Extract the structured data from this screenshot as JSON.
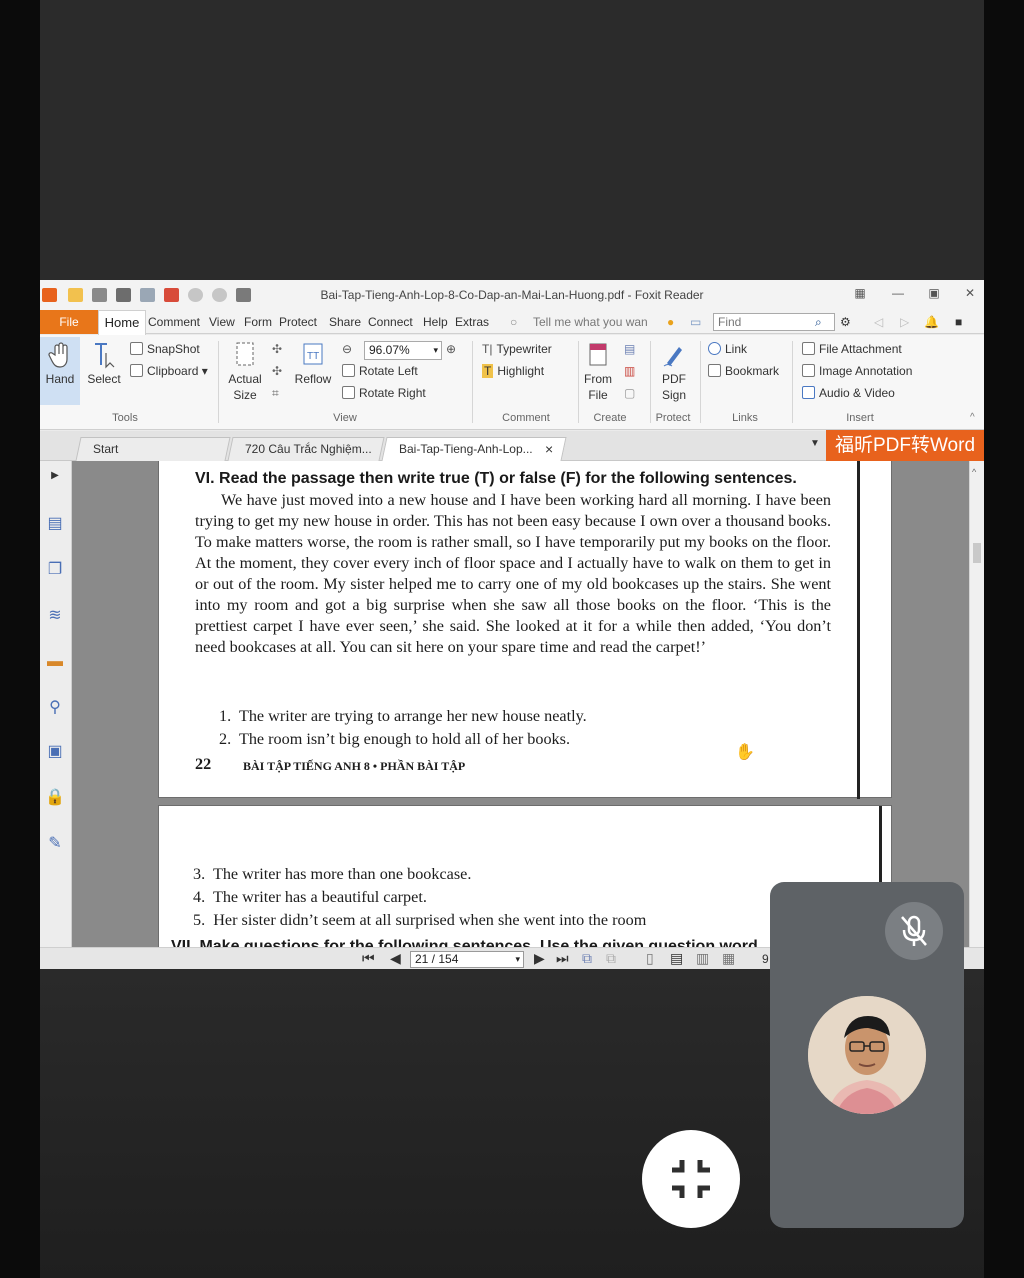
{
  "window": {
    "title": "Bai-Tap-Tieng-Anh-Lop-8-Co-Dap-an-Mai-Lan-Huong.pdf - Foxit Reader"
  },
  "menu": {
    "file": "File",
    "home": "Home",
    "items": [
      "Comment",
      "View",
      "Form",
      "Protect",
      "Share",
      "Connect",
      "Help",
      "Extras"
    ],
    "tell_me": "Tell me what you wan",
    "find_placeholder": "Find"
  },
  "ribbon": {
    "tools": {
      "hand": "Hand",
      "select": "Select",
      "snapshot": "SnapShot",
      "clipboard": "Clipboard",
      "label": "Tools"
    },
    "view": {
      "actual_size": [
        "Actual",
        "Size"
      ],
      "reflow": "Reflow",
      "zoom": "96.07%",
      "rotate_left": "Rotate Left",
      "rotate_right": "Rotate Right",
      "label": "View"
    },
    "comment": {
      "typewriter": "Typewriter",
      "highlight": "Highlight",
      "label": "Comment"
    },
    "create": {
      "from_file": [
        "From",
        "File"
      ],
      "label": "Create"
    },
    "protect": {
      "pdf_sign": [
        "PDF",
        "Sign"
      ],
      "label": "Protect"
    },
    "links": {
      "link": "Link",
      "bookmark": "Bookmark",
      "label": "Links"
    },
    "insert": {
      "file_attachment": "File Attachment",
      "image_annotation": "Image Annotation",
      "audio_video": "Audio & Video",
      "label": "Insert"
    }
  },
  "tabs": [
    {
      "label": "Start"
    },
    {
      "label": "720 Câu Trắc Nghiệm..."
    },
    {
      "label": "Bai-Tap-Tieng-Anh-Lop...",
      "close": "×"
    }
  ],
  "promo": "福昕PDF转Word",
  "document": {
    "heading": "VI. Read the passage then write true (T) or false (F) for the following sentences.",
    "passage": "We have just moved into a new house and I have been working hard all morning. I have been trying to get my new house in order. This has not been easy because I own over a thousand books. To make matters worse, the room is rather small, so I have temporarily put my books on the floor. At the moment, they cover every inch of floor space and I actually have to walk on them to get in or out of the room. My sister helped me to carry one of my old bookcases up the stairs. She went into my room and got a big surprise when she saw all those books on the floor. ‘This is the prettiest carpet I have ever seen,’ she said. She looked at it for a while then added, ‘You don’t need bookcases at all. You can sit here on your spare time and read the carpet!’",
    "items_page1": [
      "1.  The writer are trying to arrange her new house neatly.",
      "2.  The room isn’t big enough to hold all of her books."
    ],
    "page_number": "22",
    "footer": "BÀI TẬP TIẾNG ANH 8 • PHẦN BÀI TẬP",
    "items_page2": [
      "3.  The writer has more than one bookcase.",
      "4.  The writer has a beautiful carpet.",
      "5.  Her sister didn’t seem at all surprised when she went into the room"
    ],
    "next_heading": "VII. Make questions for the following sentences. Use the given question word"
  },
  "status": {
    "page": "21 / 154",
    "zoom_partial": "9"
  }
}
